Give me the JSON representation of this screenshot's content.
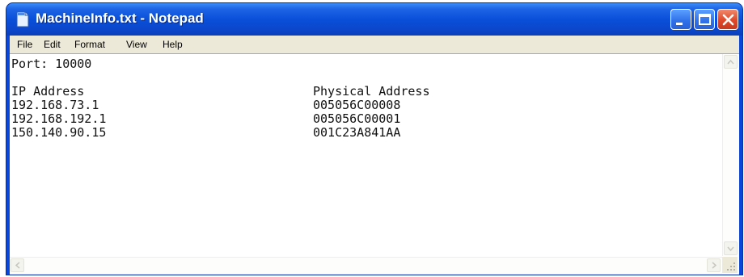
{
  "window": {
    "title": "MachineInfo.txt - Notepad"
  },
  "menu": {
    "file": "File",
    "edit": "Edit",
    "format": "Format",
    "view": "View",
    "help": "Help"
  },
  "document": {
    "port_line": "Port: 10000",
    "header_ip": "IP Address",
    "header_mac": "Physical Address",
    "rows": [
      {
        "ip": "192.168.73.1",
        "mac": "005056C00008"
      },
      {
        "ip": "192.168.192.1",
        "mac": "005056C00001"
      },
      {
        "ip": "150.140.90.15",
        "mac": "001C23A841AA"
      }
    ]
  },
  "icons": {
    "app": "notepad-icon",
    "minimize": "minimize-icon",
    "maximize": "maximize-icon",
    "close": "close-icon"
  },
  "colors": {
    "titlebar": "#0a4fd9",
    "close_button": "#e0482a",
    "menubar": "#ece9d8"
  }
}
